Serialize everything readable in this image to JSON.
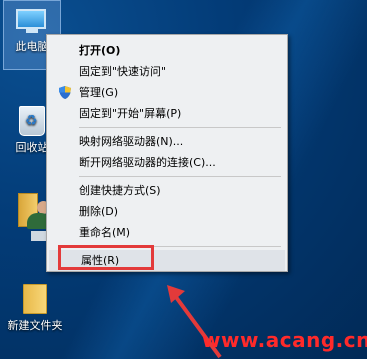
{
  "desktop": {
    "icons": [
      {
        "label": "此电脑"
      },
      {
        "label": "回收站"
      },
      {
        "label": "新建文件夹"
      }
    ]
  },
  "context_menu": {
    "items": [
      {
        "label": "打开(O)",
        "bold": true
      },
      {
        "label": "固定到\"快速访问\""
      },
      {
        "label": "管理(G)",
        "icon": "shield-icon"
      },
      {
        "label": "固定到\"开始\"屏幕(P)"
      },
      {
        "label": "映射网络驱动器(N)..."
      },
      {
        "label": "断开网络驱动器的连接(C)..."
      },
      {
        "label": "创建快捷方式(S)"
      },
      {
        "label": "删除(D)"
      },
      {
        "label": "重命名(M)"
      },
      {
        "label": "属性(R)"
      }
    ]
  },
  "annotation": {
    "highlight_color": "#e33a3a"
  },
  "watermark": {
    "text": "www.acang.cn",
    "color": "#ff2a2a"
  }
}
